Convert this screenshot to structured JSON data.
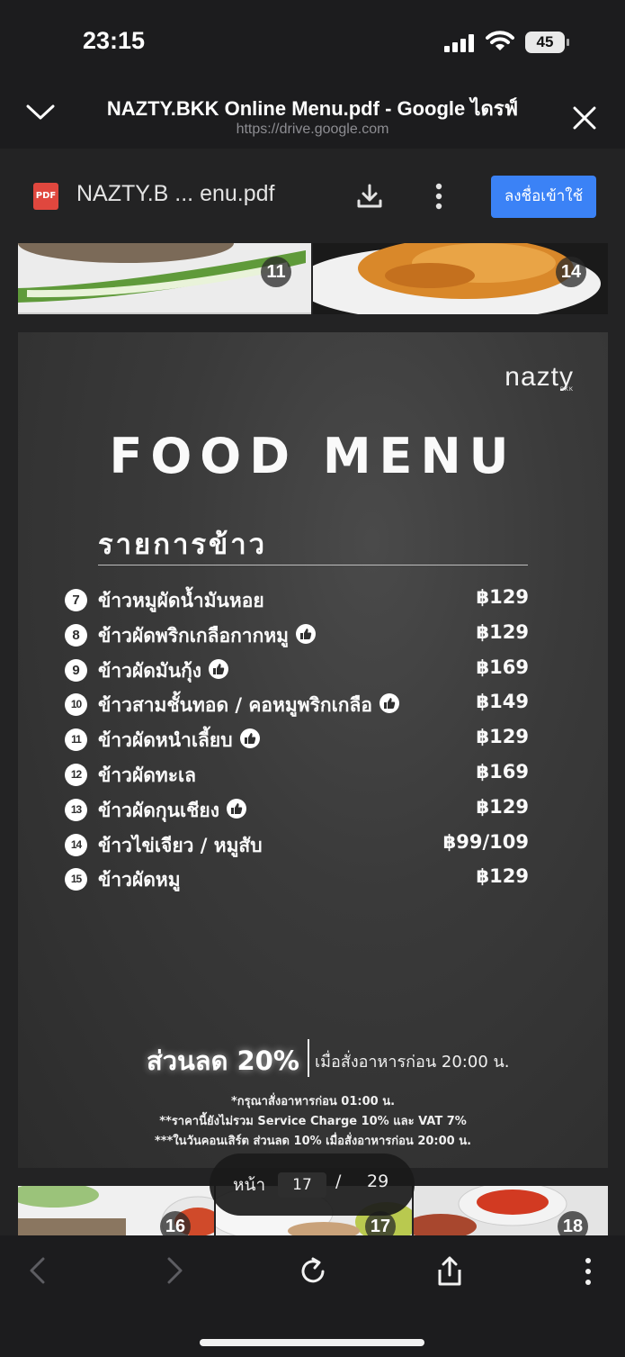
{
  "status_bar": {
    "time": "23:15",
    "battery": "45"
  },
  "title_bar": {
    "title": "NAZTY.BKK Online Menu.pdf - Google ไดรฟ์",
    "url": "https://drive.google.com"
  },
  "doc_toolbar": {
    "file_icon": "PDF",
    "file_name": "NAZTY.B ... enu.pdf",
    "signin_label": "ลงชื่อเข้าใช้"
  },
  "thumbnails_top": [
    "11",
    "14"
  ],
  "menu_page": {
    "brand": "nazty",
    "brand_sub": "BKK",
    "title": "FOOD MENU",
    "section": "รายการข้าว",
    "items": [
      {
        "num": "7",
        "name": "ข้าวหมูผัดน้ำมันหอย",
        "price": "฿129",
        "recommended": false
      },
      {
        "num": "8",
        "name": "ข้าวผัดพริกเกลือกากหมู",
        "price": "฿129",
        "recommended": true
      },
      {
        "num": "9",
        "name": "ข้าวผัดมันกุ้ง",
        "price": "฿169",
        "recommended": true
      },
      {
        "num": "10",
        "name": "ข้าวสามชั้นทอด / คอหมูพริกเกลือ",
        "price": "฿149",
        "recommended": true
      },
      {
        "num": "11",
        "name": "ข้าวผัดหนำเลี้ยบ",
        "price": "฿129",
        "recommended": true
      },
      {
        "num": "12",
        "name": "ข้าวผัดทะเล",
        "price": "฿169",
        "recommended": false
      },
      {
        "num": "13",
        "name": "ข้าวผัดกุนเชียง",
        "price": "฿129",
        "recommended": true
      },
      {
        "num": "14",
        "name": "ข้าวไข่เจียว / หมูสับ",
        "price": "฿99/109",
        "recommended": false
      },
      {
        "num": "15",
        "name": "ข้าวผัดหมู",
        "price": "฿129",
        "recommended": false
      }
    ],
    "discount": "ส่วนลด 20%",
    "discount_note": "เมื่อสั่งอาหารก่อน 20:00 น.",
    "footnotes": [
      "*กรุณาสั่งอาหารก่อน 01:00 น.",
      "**ราคานี้ยังไม่รวม Service Charge 10% และ VAT 7%",
      "***ในวันคอนเสิร์ต ส่วนลด 10% เมื่อสั่งอาหารก่อน 20:00 น."
    ]
  },
  "thumbnails_bottom": [
    "16",
    "17",
    "18"
  ],
  "pager": {
    "label": "หน้า",
    "current": "17",
    "separator": "/",
    "total": "29"
  },
  "colors": {
    "accent": "#3b82f6",
    "pdf_red": "#e0473e",
    "page_bg": "#3a3a3a"
  }
}
